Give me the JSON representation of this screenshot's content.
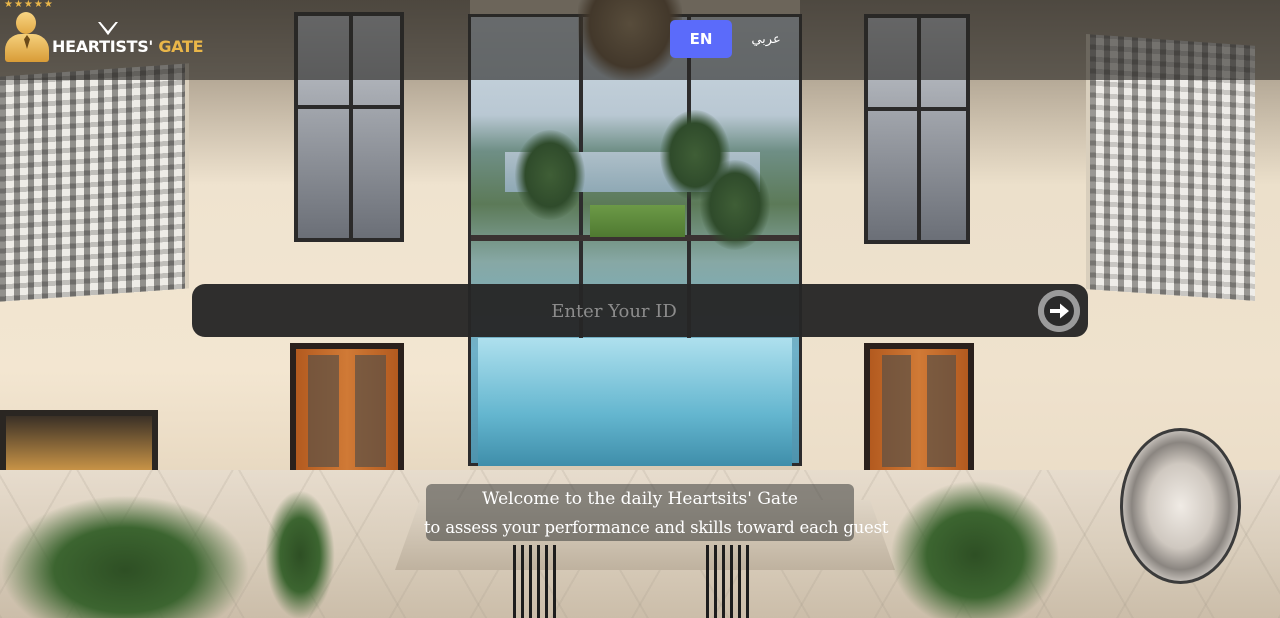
{
  "header": {
    "logo": {
      "text_main": "HEARTISTS'",
      "text_accent": "GATE"
    },
    "languages": {
      "en_label": "EN",
      "ar_label": "عربي",
      "selected": "EN"
    }
  },
  "login": {
    "id_input": {
      "placeholder": "Enter Your ID",
      "value": ""
    },
    "submit_icon": "arrow-right-circle-icon"
  },
  "welcome": {
    "line1": "Welcome to the daily Heartsits' Gate",
    "line2": "to assess your performance and skills toward each guest"
  },
  "colors": {
    "accent": "#5b6bfa",
    "logo_gold": "#e9b649",
    "input_bar": "#262626"
  }
}
